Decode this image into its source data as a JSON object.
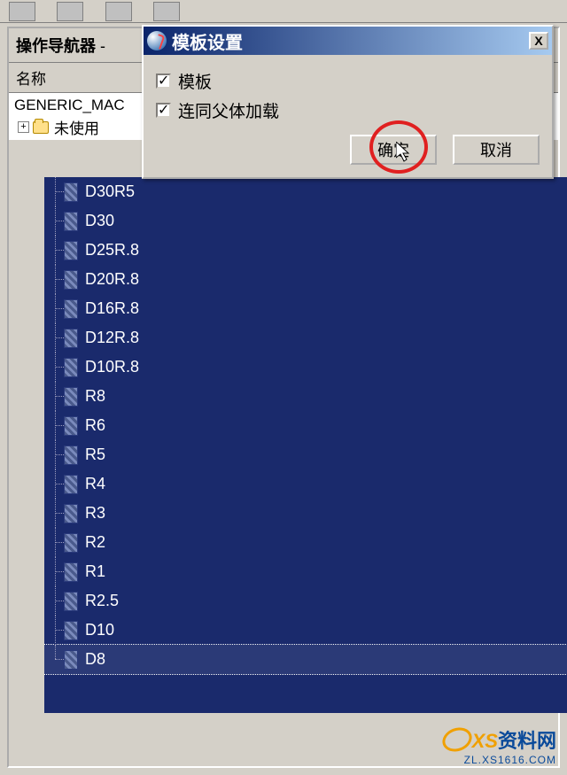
{
  "navigator": {
    "title": "操作导航器",
    "dash": " - ",
    "column_header": "名称",
    "root": "GENERIC_MAC",
    "unused_label": "未使用"
  },
  "tools": [
    {
      "label": "D30R5",
      "selected": false
    },
    {
      "label": "D30",
      "selected": false
    },
    {
      "label": "D25R.8",
      "selected": false
    },
    {
      "label": "D20R.8",
      "selected": false
    },
    {
      "label": "D16R.8",
      "selected": false
    },
    {
      "label": "D12R.8",
      "selected": false
    },
    {
      "label": "D10R.8",
      "selected": false
    },
    {
      "label": "R8",
      "selected": false
    },
    {
      "label": "R6",
      "selected": false
    },
    {
      "label": "R5",
      "selected": false
    },
    {
      "label": "R4",
      "selected": false
    },
    {
      "label": "R3",
      "selected": false
    },
    {
      "label": "R2",
      "selected": false
    },
    {
      "label": "R1",
      "selected": false
    },
    {
      "label": "R2.5",
      "selected": false
    },
    {
      "label": "D10",
      "selected": false
    },
    {
      "label": "D8",
      "selected": true
    }
  ],
  "dialog": {
    "title": "模板设置",
    "close": "X",
    "checkbox1": "模板",
    "checkbox2": "连同父体加载",
    "ok": "确定",
    "cancel": "取消"
  },
  "watermark": {
    "brand_xs": "XS",
    "brand_rest": "资料网",
    "url": "ZL.XS1616.COM"
  }
}
